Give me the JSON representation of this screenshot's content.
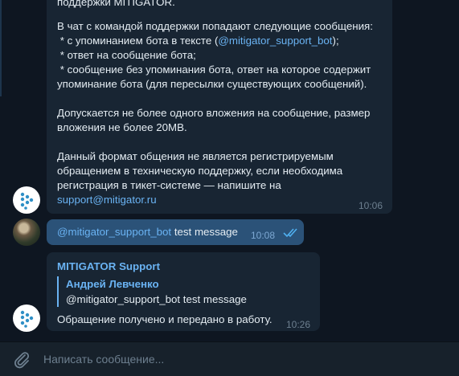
{
  "messages": {
    "first": {
      "lines": [
        "поддержки MITIGATOR.",
        "",
        "В чат с командой поддержки попадают следующие сообщения:",
        " * с упоминанием бота в тексте (",
        " * ответ на сообщение бота;",
        " * сообщение без упоминания бота, ответ на которое содержит",
        "упоминание бота (для пересылки существующих сообщений).",
        "",
        "Допускается не более одного вложения на сообщение, размер",
        "вложения не более 20MB.",
        "",
        "Данный формат общения не является регистрируемым",
        "обращением в техническую поддержку, если необходима",
        "регистрация в тикет-системе — напишите на"
      ],
      "line3_link": "@mitigator_support_bot",
      "line3_tail": ");",
      "email": "support@mitigator.ru",
      "time": "10:06"
    },
    "outgoing": {
      "mention": "@mitigator_support_bot",
      "text": " test message",
      "time": "10:08"
    },
    "reply": {
      "sender": "MITIGATOR Support",
      "quoted_author": "Андрей Левченко",
      "quoted_text": "@mitigator_support_bot test message",
      "text": "Обращение получено и передано в работу.",
      "time": "10:26"
    }
  },
  "composer": {
    "placeholder": "Написать сообщение..."
  },
  "icons": {
    "attach": "paperclip-icon",
    "read": "double-check-icon",
    "bot_avatar": "mitigator-logo-icon"
  },
  "colors": {
    "background": "#0e1621",
    "bubble_in": "#182533",
    "bubble_out": "#2b5278",
    "link": "#6ab3f3",
    "composer": "#17212b"
  }
}
